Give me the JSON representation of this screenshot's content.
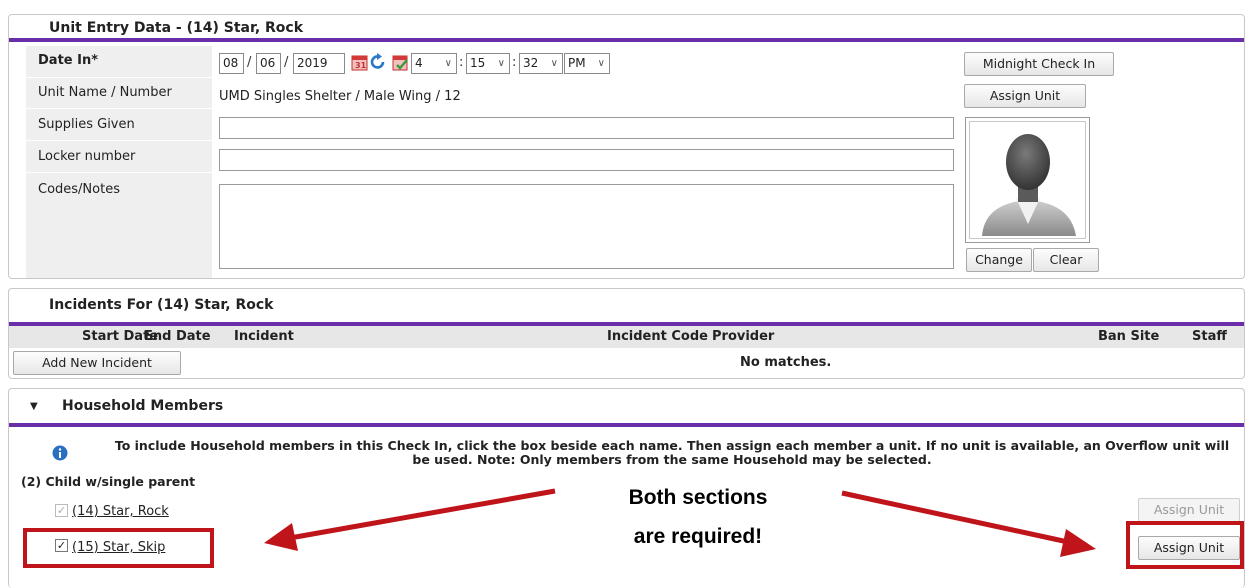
{
  "unit_entry": {
    "title": "Unit Entry Data - (14) Star, Rock",
    "date_label": "Date In*",
    "date_month": "08",
    "date_day": "06",
    "date_year": "2019",
    "date_sep": "/",
    "time_hour": "4",
    "time_minute": "15",
    "time_second": "32",
    "time_ampm": "PM",
    "time_sep": ":",
    "midnight_button": "Midnight Check In",
    "unit_label": "Unit Name / Number",
    "unit_value": "UMD Singles Shelter / Male Wing / 12",
    "assign_unit_button": "Assign Unit",
    "supplies_label": "Supplies Given",
    "supplies_value": "",
    "locker_label": "Locker number",
    "locker_value": "",
    "codes_label": "Codes/Notes",
    "codes_value": "",
    "change_button": "Change",
    "clear_button": "Clear"
  },
  "incidents": {
    "title": "Incidents For (14) Star, Rock",
    "columns": [
      "Start Date",
      "End Date",
      "Incident",
      "Incident Code",
      "Provider",
      "Ban Site",
      "Staff"
    ],
    "add_button": "Add New Incident",
    "empty_text": "No matches."
  },
  "household": {
    "toggle_glyph": "▼",
    "title": "Household Members",
    "info_text": "To include Household members in this Check In, click the box beside each name. Then assign each member a unit. If no unit is available, an Overflow unit will be used. Note: Only members from the same Household may be selected.",
    "group_label": "(2) Child w/single parent",
    "members": [
      {
        "name": "(14) Star, Rock",
        "checked": true,
        "disabled": true,
        "button": "Assign Unit"
      },
      {
        "name": "(15) Star, Skip",
        "checked": true,
        "disabled": false,
        "button": "Assign Unit"
      }
    ]
  },
  "annotation": {
    "line1": "Both sections",
    "line2": "are required!",
    "color": "#c0141b"
  },
  "colors": {
    "accent": "#6a2ea8",
    "label_bg": "#efefef",
    "info_blue": "#2a6fc0"
  }
}
